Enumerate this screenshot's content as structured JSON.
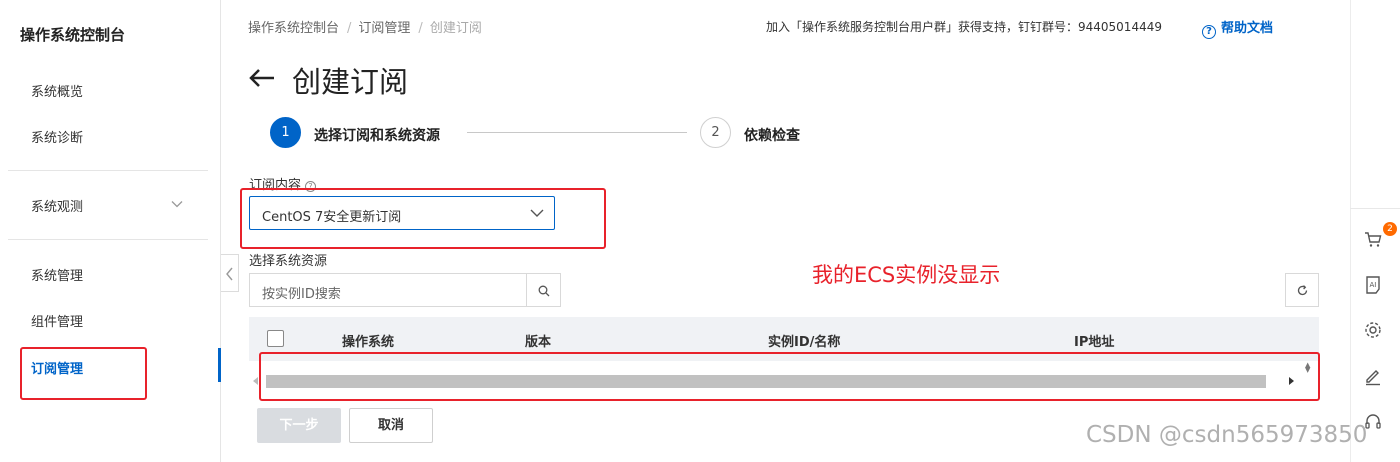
{
  "sidebar": {
    "title": "操作系统控制台",
    "items": [
      {
        "label": "系统概览"
      },
      {
        "label": "系统诊断"
      },
      {
        "label": "系统观测"
      },
      {
        "label": "系统管理"
      },
      {
        "label": "组件管理"
      },
      {
        "label": "订阅管理"
      }
    ],
    "active_item": "订阅管理"
  },
  "header": {
    "breadcrumb": [
      "操作系统控制台",
      "订阅管理",
      "创建订阅"
    ],
    "support_text": "加入「操作系统服务控制台用户群」获得支持，钉钉群号：94405014449",
    "help_label": "帮助文档"
  },
  "page": {
    "title": "创建订阅",
    "steps": [
      {
        "number": "1",
        "label": "选择订阅和系统资源",
        "state": "active"
      },
      {
        "number": "2",
        "label": "依赖检查",
        "state": "pending"
      }
    ]
  },
  "form": {
    "subscription_label": "订阅内容",
    "subscription_value": "CentOS 7安全更新订阅",
    "resource_label": "选择系统资源",
    "search_placeholder": "按实例ID搜索"
  },
  "annotation": {
    "text": "我的ECS实例没显示",
    "color": "#e8222b"
  },
  "table": {
    "columns": [
      "操作系统",
      "版本",
      "实例ID/名称",
      "IP地址"
    ],
    "rows": []
  },
  "buttons": {
    "next": "下一步",
    "cancel": "取消"
  },
  "right_rail": {
    "cart_badge": "2",
    "icons": [
      "cart-icon",
      "ai-icon",
      "gear-icon",
      "edit-icon",
      "headset-icon"
    ]
  },
  "watermark": "CSDN @csdn565973850",
  "colors": {
    "primary": "#0064c8",
    "highlight_red": "#e8222b",
    "badge_orange": "#ff6a00"
  }
}
